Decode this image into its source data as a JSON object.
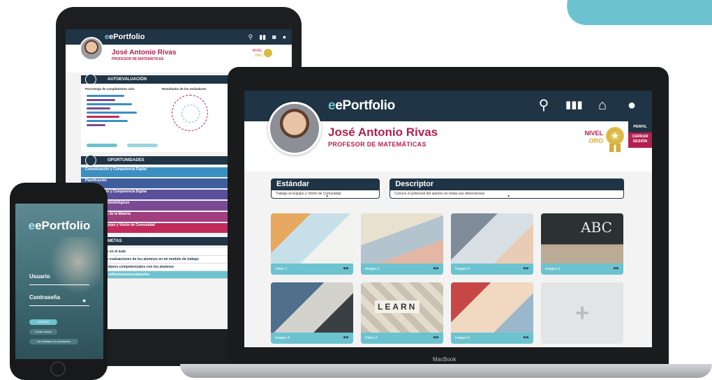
{
  "colors": {
    "navy": "#1f3444",
    "accent_teal": "#6cc3cf",
    "brand_crimson": "#b3204f",
    "gold": "#d4ac3a",
    "background": "#f3f3f4"
  },
  "laptop": {
    "brand_label": "MacBook",
    "app": {
      "logo": "ePortfolio",
      "header_icons": [
        "search-icon",
        "stats-icon",
        "home-icon",
        "user-icon"
      ],
      "profile": {
        "name": "José Antonio Rivas",
        "role": "PROFESOR DE MATEMÁTICAS",
        "level_label": "NIVEL",
        "level_value": "ORO"
      },
      "side_menu": {
        "perfil": "PERFIL",
        "logout": "CERRAR SESIÓN"
      },
      "fields": {
        "standard_title": "Estándar",
        "standard_value": "Trabajo en Equipo y Visión de Comunidad",
        "descriptor_title": "Descriptor",
        "descriptor_value": "Conoce el potencial del alumno en todas sus dimensiones"
      },
      "cards": [
        {
          "label": "Vídeo 1"
        },
        {
          "label": "Imagen 1"
        },
        {
          "label": "Imagen 2"
        },
        {
          "label": "Imagen 3",
          "thumb_text": "ABC"
        },
        {
          "label": "Imagen 4"
        },
        {
          "label": "Vídeo 2",
          "thumb_text": "LEARN"
        },
        {
          "label": "Imagen 5"
        }
      ],
      "add_symbol": "+"
    }
  },
  "tablet": {
    "logo": "ePortfolio",
    "name": "José Antonio Rivas",
    "role": "PROFESOR DE MATEMÁTICAS",
    "level_label": "NIVEL",
    "level_value": "ORO",
    "self_eval": {
      "title": "AUTOEVALUACIÓN",
      "left_subtitle": "Porcentaje de cumplimiento ción",
      "right_subtitle": "Resultados de los estándares"
    },
    "opportunities": {
      "title": "OPORTUNIDADES",
      "items": [
        {
          "label": "Comunicación y Competencia Digital",
          "color": "#3b8fc3"
        },
        {
          "label": "Planificación",
          "color": "#3f5e9e"
        },
        {
          "label": "Comunicación y Competencia Digital",
          "color": "#5a4f9b"
        },
        {
          "label": "Estrategias Metodológicas",
          "color": "#7b4a94"
        },
        {
          "label": "Conocimiento de la Materia",
          "color": "#a03e7e"
        },
        {
          "label": "Trabajo en Equipo y Visión de Comunidad",
          "color": "#c12b5c"
        }
      ]
    },
    "goals": {
      "title": "METAS",
      "items": [
        "Crear equipos en el aula",
        "Incorporar las evaluaciones de los alumnos en mi modelo de trabajo",
        "Trabajar estándares competenciales con los alumnos",
        "Desarrollar la reflexión/autoevaluación"
      ]
    }
  },
  "phone": {
    "logo": "ePortfolio",
    "user_label": "Usuario",
    "password_label": "Contraseña",
    "enter_button": "ENTRAR",
    "create_account": "Crear cuenta",
    "forgot_password": "He olvidado mi contraseña"
  }
}
